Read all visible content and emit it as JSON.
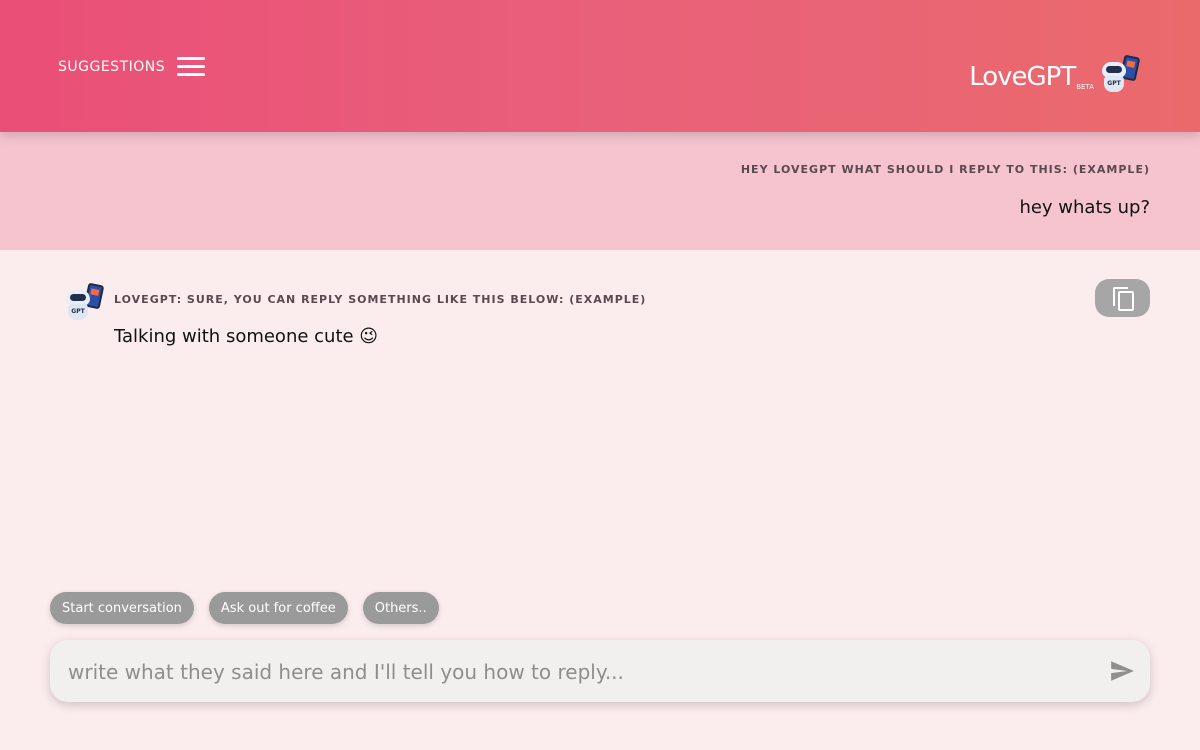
{
  "header": {
    "suggestions_label": "SUGGESTIONS",
    "brand_name": "LoveGPT",
    "brand_badge": "BETA",
    "robot_badge": "GPT"
  },
  "user_message": {
    "label": "HEY LOVEGPT WHAT SHOULD I REPLY TO THIS: (EXAMPLE)",
    "text": "hey whats up?"
  },
  "bot_message": {
    "label": "LOVEGPT: SURE, YOU CAN REPLY SOMETHING LIKE THIS BELOW: (EXAMPLE)",
    "text": "Talking with someone cute 😉",
    "avatar_badge": "GPT"
  },
  "chips": [
    {
      "label": "Start conversation"
    },
    {
      "label": "Ask out for coffee"
    },
    {
      "label": "Others.."
    }
  ],
  "input": {
    "placeholder": "write what they said here and I'll tell you how to reply...",
    "value": ""
  },
  "icons": {
    "menu": "hamburger-icon",
    "copy": "copy-icon",
    "send": "send-icon",
    "robot": "robot-mascot-icon"
  },
  "colors": {
    "header_start": "#ea4f77",
    "header_end": "#ea6a6c",
    "user_band": "#f5c4cf",
    "page_bg": "#fbeced",
    "chip_bg": "#9a9a9a"
  }
}
